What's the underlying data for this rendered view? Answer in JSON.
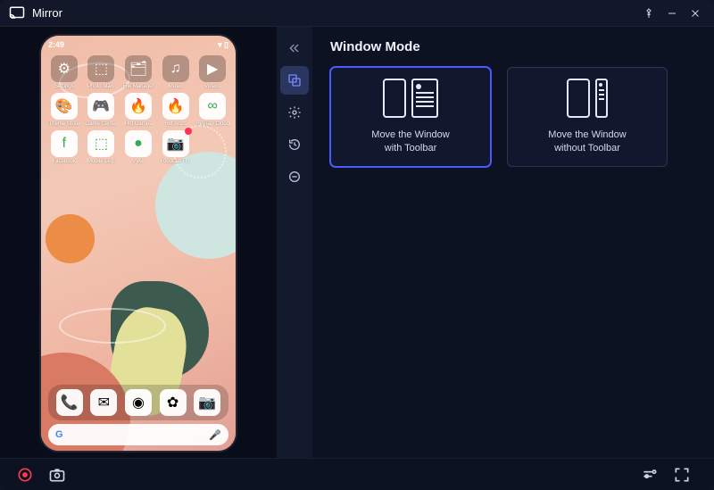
{
  "window": {
    "title": "Mirror",
    "controls": {
      "pin": "pin",
      "minimize": "minimize",
      "close": "close"
    }
  },
  "phone": {
    "status_time": "2:49",
    "apps": [
      {
        "label": "Settings",
        "icon": "⚙",
        "dark": true
      },
      {
        "label": "Photo Man.",
        "icon": "⬚",
        "dark": true
      },
      {
        "label": "File Manager",
        "icon": "🗂",
        "dark": true
      },
      {
        "label": "Music",
        "icon": "♫",
        "dark": true
      },
      {
        "label": "Videos",
        "icon": "▶",
        "dark": true
      },
      {
        "label": "Theme Store",
        "icon": "🎨"
      },
      {
        "label": "Game Center",
        "icon": "🎮"
      },
      {
        "label": "Hot Games",
        "icon": "🔥"
      },
      {
        "label": "Hot Apps",
        "icon": "🔥"
      },
      {
        "label": "HeyTap Cloud",
        "icon": "∞"
      },
      {
        "label": "Facebook",
        "icon": "f"
      },
      {
        "label": "Mobile Leg.",
        "icon": "⬚"
      },
      {
        "label": "Vyke",
        "icon": "●"
      },
      {
        "label": "FoodLab Ph.",
        "icon": "📷",
        "badge": true
      }
    ],
    "dock": [
      {
        "name": "phone",
        "icon": "📞"
      },
      {
        "name": "messages",
        "icon": "✉"
      },
      {
        "name": "chrome",
        "icon": "◉"
      },
      {
        "name": "gallery",
        "icon": "✿"
      },
      {
        "name": "camera",
        "icon": "📷"
      }
    ],
    "search_label": "G"
  },
  "sidebar": {
    "items": [
      {
        "name": "collapse",
        "active": false
      },
      {
        "name": "windows",
        "active": true
      },
      {
        "name": "settings",
        "active": false
      },
      {
        "name": "history",
        "active": false
      },
      {
        "name": "power",
        "active": false
      }
    ]
  },
  "panel": {
    "title": "Window Mode",
    "cards": [
      {
        "line1": "Move the Window",
        "line2": "with Toolbar",
        "selected": true
      },
      {
        "line1": "Move the Window",
        "line2": "without Toolbar",
        "selected": false
      }
    ]
  },
  "bottombar": {
    "record": "record",
    "screenshot": "screenshot",
    "list": "list",
    "fullscreen": "fullscreen"
  }
}
